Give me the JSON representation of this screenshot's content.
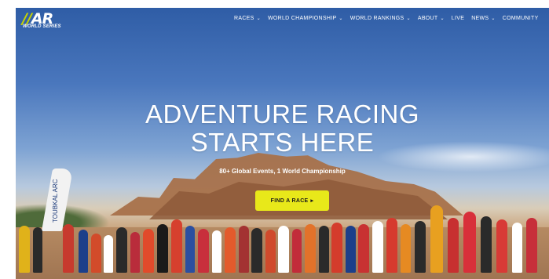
{
  "brand": {
    "logo_text": "AR",
    "logo_sub": "WORLD SERIES",
    "accent": "#c8d400"
  },
  "nav": {
    "items": [
      {
        "label": "RACES",
        "has_dropdown": true
      },
      {
        "label": "WORLD CHAMPIONSHIP",
        "has_dropdown": true
      },
      {
        "label": "WORLD RANKINGS",
        "has_dropdown": true
      },
      {
        "label": "ABOUT",
        "has_dropdown": true
      },
      {
        "label": "LIVE",
        "has_dropdown": false
      },
      {
        "label": "NEWS",
        "has_dropdown": true
      },
      {
        "label": "COMMUNITY",
        "has_dropdown": false
      }
    ]
  },
  "hero": {
    "title_line1": "ADVENTURE RACING",
    "title_line2": "STARTS HERE",
    "subtitle": "80+ Global Events, 1 World Championship",
    "cta_label": "FIND A RACE",
    "cta_arrow": "▸",
    "cta_color": "#e8e81a",
    "flag_text": "TOUBKAL ARC"
  }
}
